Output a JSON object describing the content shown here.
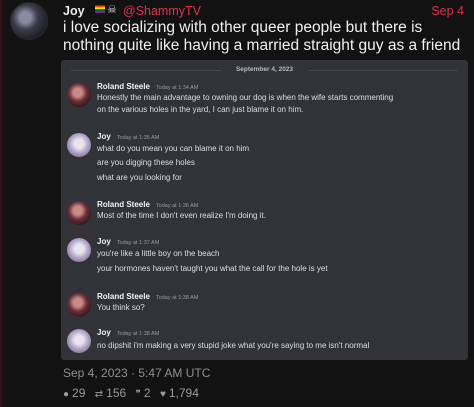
{
  "post": {
    "author": "Joy",
    "handle": "@ShammyTV",
    "date": "Sep 4",
    "text": "i love socializing with other queer people but there is nothing quite like having a married straight guy as a friend",
    "timestamp": "Sep 4, 2023 · 5:47 AM UTC"
  },
  "stats": {
    "comments": "29",
    "retweets": "156",
    "quotes": "2",
    "likes": "1,794"
  },
  "discord": {
    "date_separator": "September 4, 2023",
    "messages": [
      {
        "author": "Roland Steele",
        "time": "Today at 1:34 AM",
        "lines": [
          "Honestly the main advantage to owning our dog is when the wife starts commenting",
          "on the various holes in the yard, I can just blame it on him."
        ]
      },
      {
        "author": "Joy",
        "time": "Today at 1:35 AM",
        "lines": [
          "what do you mean you can blame it on him",
          "are you digging these holes",
          "what are you looking for"
        ]
      },
      {
        "author": "Roland Steele",
        "time": "Today at 1:36 AM",
        "lines": [
          "Most of the time I don't even realize I'm doing it."
        ]
      },
      {
        "author": "Joy",
        "time": "Today at 1:37 AM",
        "lines": [
          "you're like a little boy on the beach",
          "your hormones haven't taught you what the call for the hole is yet"
        ]
      },
      {
        "author": "Roland Steele",
        "time": "Today at 1:38 AM",
        "lines": [
          "You think so?"
        ]
      },
      {
        "author": "Joy",
        "time": "Today at 1:38 AM",
        "lines": [
          "no dipshit i'm making a very stupid joke what you're saying to me isn't normal"
        ]
      }
    ]
  },
  "icons": [
    "pride-flag-icon",
    "skull-icon",
    "comment-icon",
    "retweet-icon",
    "quote-icon",
    "heart-icon"
  ]
}
